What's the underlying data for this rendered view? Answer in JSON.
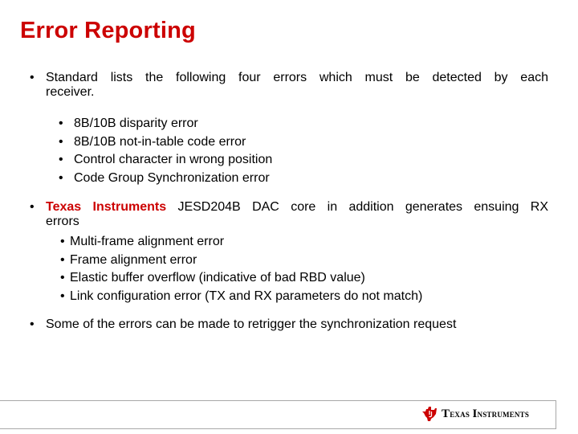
{
  "slide": {
    "title": "Error Reporting",
    "bullets": [
      {
        "line1": "Standard lists the following  four errors which must be detected by each",
        "line2": "receiver.",
        "sub_items": [
          "8B/10B disparity error",
          "8B/10B not-in-table code error",
          "Control character in wrong position",
          "Code Group Synchronization error"
        ]
      },
      {
        "brand": "Texas Instruments",
        "line1_rest": " JESD204B  DAC core in addition generates ensuing RX",
        "line2": "errors",
        "sub_items": [
          "Multi-frame alignment error",
          "Frame alignment error",
          "Elastic buffer overflow (indicative of bad RBD value)",
          "Link configuration error (TX and RX parameters do not match)"
        ]
      },
      {
        "text": "Some of the errors can be made to retrigger the synchronization request"
      }
    ],
    "bullet_glyph": "•"
  },
  "footer": {
    "logo_icon": "ti-logo-icon",
    "logo_text_1_big": "T",
    "logo_text_1": "exas ",
    "logo_text_2_big": "I",
    "logo_text_2": "nstruments"
  },
  "colors": {
    "accent": "#cc0000",
    "footer_border": "#a8a8a8"
  }
}
